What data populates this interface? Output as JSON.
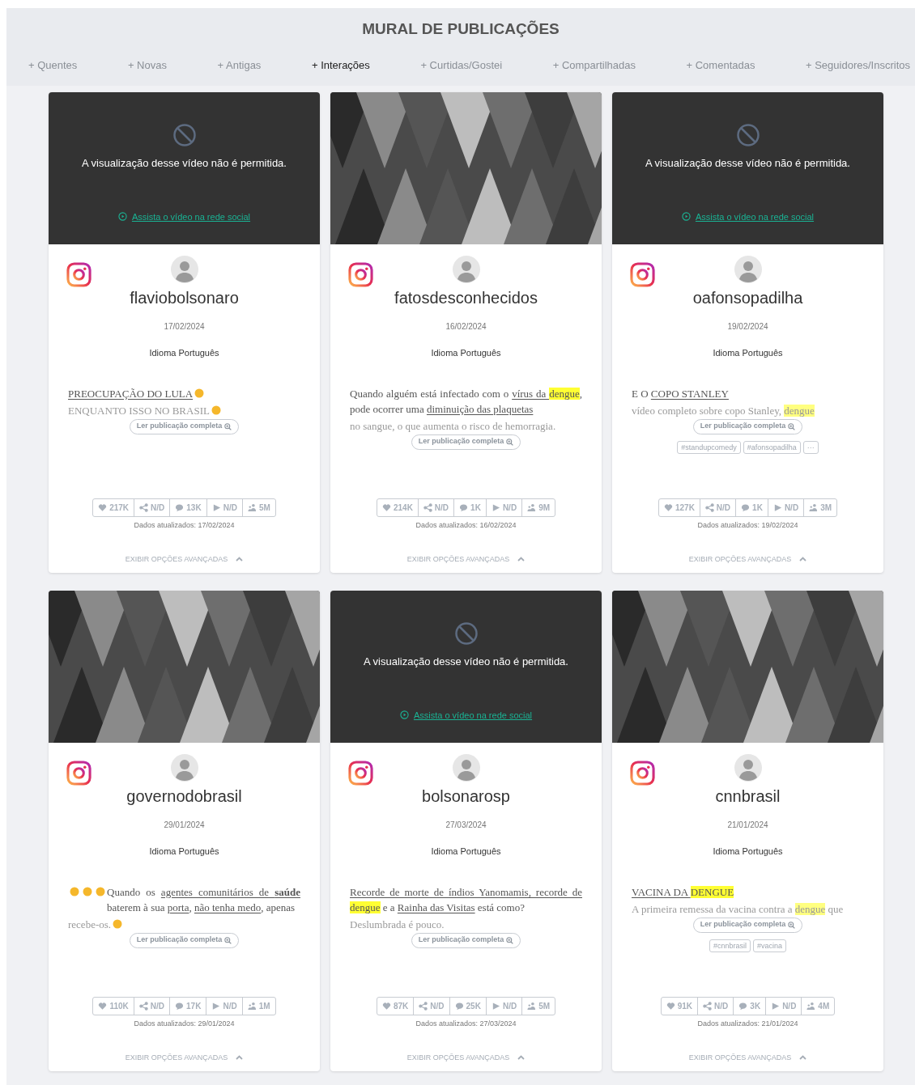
{
  "title": "MURAL DE PUBLICAÇÕES",
  "tabs": [
    {
      "label": "+ Quentes",
      "selected": false
    },
    {
      "label": "+ Novas",
      "selected": false
    },
    {
      "label": "+ Antigas",
      "selected": false
    },
    {
      "label": "+ Interações",
      "selected": true
    },
    {
      "label": "+ Curtidas/Gostei",
      "selected": false
    },
    {
      "label": "+ Compartilhadas",
      "selected": false
    },
    {
      "label": "+ Comentadas",
      "selected": false
    },
    {
      "label": "+ Seguidores/Inscritos",
      "selected": false
    }
  ],
  "posts": [
    {
      "media": {
        "kind": "blocked",
        "message": "A visualização desse vídeo não é permitida.",
        "link": "Assista o vídeo na rede social"
      },
      "username": "flaviobolsonaro",
      "date": "17/02/2024",
      "language": "Idioma Português",
      "text": [
        {
          "kind": "link",
          "text": "PREOCUPAÇÃO DO LULA"
        },
        {
          "kind": "emoji"
        }
      ],
      "excerpt": [
        {
          "kind": "plain",
          "text": "ENQUANTO ISSO NO BRASIL"
        },
        {
          "kind": "emoji"
        }
      ],
      "read_more": "Ler publicação completa",
      "stats": {
        "likes": "217K",
        "shares": "N/D",
        "comments": "13K",
        "views": "N/D",
        "followers": "5M"
      },
      "updated": "Dados atualizados: 17/02/2024",
      "advanced": "EXIBIR OPÇÕES AVANÇADAS"
    },
    {
      "media": {
        "kind": "picture"
      },
      "username": "fatosdesconhecidos",
      "date": "16/02/2024",
      "language": "Idioma Português",
      "text": [
        {
          "kind": "plain",
          "text": "Quando alguém está infectado com o "
        },
        {
          "kind": "link",
          "text": "vírus da "
        },
        {
          "kind": "highlight",
          "text": "dengue"
        },
        {
          "kind": "plain",
          "text": ", pode ocorrer uma "
        },
        {
          "kind": "link",
          "text": "diminuição das plaquetas"
        }
      ],
      "excerpt": [
        {
          "kind": "plain",
          "text": "no sangue, o que aumenta o risco de hemorragia."
        }
      ],
      "read_more": "Ler publicação completa",
      "stats": {
        "likes": "214K",
        "shares": "N/D",
        "comments": "1K",
        "views": "N/D",
        "followers": "9M"
      },
      "updated": "Dados atualizados: 16/02/2024",
      "advanced": "EXIBIR OPÇÕES AVANÇADAS"
    },
    {
      "media": {
        "kind": "blocked",
        "message": "A visualização desse vídeo não é permitida.",
        "link": "Assista o vídeo na rede social"
      },
      "username": "oafonsopadilha",
      "date": "19/02/2024",
      "language": "Idioma Português",
      "text": [
        {
          "kind": "plain",
          "text": "E O "
        },
        {
          "kind": "link",
          "text": "COPO STANLEY"
        }
      ],
      "excerpt": [
        {
          "kind": "plain",
          "text": "vídeo completo sobre copo Stanley, "
        },
        {
          "kind": "highlight",
          "text": "dengue"
        }
      ],
      "read_more": "Ler publicação completa",
      "tags": [
        "#standupcomedy",
        "#afonsopadilha",
        "···"
      ],
      "stats": {
        "likes": "127K",
        "shares": "N/D",
        "comments": "1K",
        "views": "N/D",
        "followers": "3M"
      },
      "updated": "Dados atualizados: 19/02/2024",
      "advanced": "EXIBIR OPÇÕES AVANÇADAS"
    },
    {
      "media": {
        "kind": "picture"
      },
      "username": "governodobrasil",
      "date": "29/01/2024",
      "language": "Idioma Português",
      "text": [
        {
          "kind": "emoji"
        },
        {
          "kind": "emoji"
        },
        {
          "kind": "emoji"
        },
        {
          "kind": "plain",
          "text": "Quando os "
        },
        {
          "kind": "link",
          "text": "agentes comunitários de "
        },
        {
          "kind": "strong",
          "text": "saúde"
        },
        {
          "kind": "plain",
          "text": " baterem à sua "
        },
        {
          "kind": "link",
          "text": "porta"
        },
        {
          "kind": "plain",
          "text": ", "
        },
        {
          "kind": "link",
          "text": "não tenha medo"
        },
        {
          "kind": "plain",
          "text": ", apenas"
        }
      ],
      "excerpt": [
        {
          "kind": "plain",
          "text": "recebe-os."
        },
        {
          "kind": "emoji"
        }
      ],
      "read_more": "Ler publicação completa",
      "stats": {
        "likes": "110K",
        "shares": "N/D",
        "comments": "17K",
        "views": "N/D",
        "followers": "1M"
      },
      "updated": "Dados atualizados: 29/01/2024",
      "advanced": "EXIBIR OPÇÕES AVANÇADAS"
    },
    {
      "media": {
        "kind": "blocked",
        "message": "A visualização desse vídeo não é permitida.",
        "link": "Assista o vídeo na rede social"
      },
      "username": "bolsonarosp",
      "date": "27/03/2024",
      "language": "Idioma Português",
      "text": [
        {
          "kind": "link",
          "text": "Recorde de morte de índios Yanomamis, recorde de "
        },
        {
          "kind": "highlight",
          "text": "dengue"
        },
        {
          "kind": "plain",
          "text": " e a "
        },
        {
          "kind": "link",
          "text": "Rainha das Visitas"
        },
        {
          "kind": "plain",
          "text": " está como?"
        }
      ],
      "excerpt": [
        {
          "kind": "plain",
          "text": "Deslumbrada é pouco."
        }
      ],
      "read_more": "Ler publicação completa",
      "stats": {
        "likes": "87K",
        "shares": "N/D",
        "comments": "25K",
        "views": "N/D",
        "followers": "5M"
      },
      "updated": "Dados atualizados: 27/03/2024",
      "advanced": "EXIBIR OPÇÕES AVANÇADAS"
    },
    {
      "media": {
        "kind": "picture"
      },
      "username": "cnnbrasil",
      "date": "21/01/2024",
      "language": "Idioma Português",
      "text": [
        {
          "kind": "link",
          "text": "VACINA DA "
        },
        {
          "kind": "highlight",
          "text": "DENGUE"
        }
      ],
      "excerpt": [
        {
          "kind": "plain",
          "text": "A primeira remessa da vacina contra a "
        },
        {
          "kind": "highlight",
          "text": "dengue"
        },
        {
          "kind": "plain",
          "text": " que"
        }
      ],
      "read_more": "Ler publicação completa",
      "tags": [
        "#cnnbrasil",
        "#vacina"
      ],
      "stats": {
        "likes": "91K",
        "shares": "N/D",
        "comments": "3K",
        "views": "N/D",
        "followers": "4M"
      },
      "updated": "Dados atualizados: 21/01/2024",
      "advanced": "EXIBIR OPÇÕES AVANÇADAS"
    }
  ]
}
